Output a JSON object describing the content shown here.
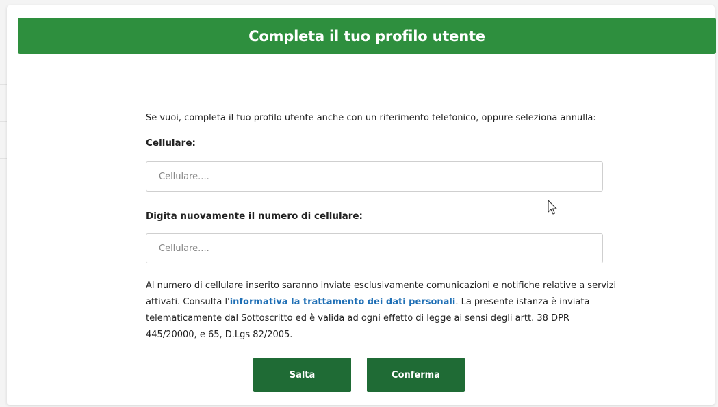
{
  "modal": {
    "title": "Completa il tuo profilo utente",
    "intro": "Se vuoi, completa il tuo profilo utente anche con un riferimento telefonico, oppure seleziona annulla:",
    "fields": [
      {
        "label": "Cellulare:",
        "placeholder": "Cellulare....",
        "value": ""
      },
      {
        "label": "Digita nuovamente il numero di cellulare:",
        "placeholder": "Cellulare....",
        "value": ""
      }
    ],
    "notice": {
      "before": "Al numero di cellulare inserito saranno inviate esclusivamente comunicazioni e notifiche relative a servizi attivati. Consulta l'",
      "link": "informativa la trattamento dei dati personali",
      "after": ". La presente istanza è inviata telematicamente dal Sottoscritto ed è valida ad ogni effetto di legge ai sensi degli artt. 38 DPR 445/20000, e 65, D.Lgs 82/2005."
    },
    "buttons": {
      "skip": "Salta",
      "confirm": "Conferma"
    }
  },
  "colors": {
    "header": "#2e8f3e",
    "button": "#1f6b35",
    "link": "#1f6fb5"
  },
  "cursor_icon": "mouse-pointer-icon"
}
